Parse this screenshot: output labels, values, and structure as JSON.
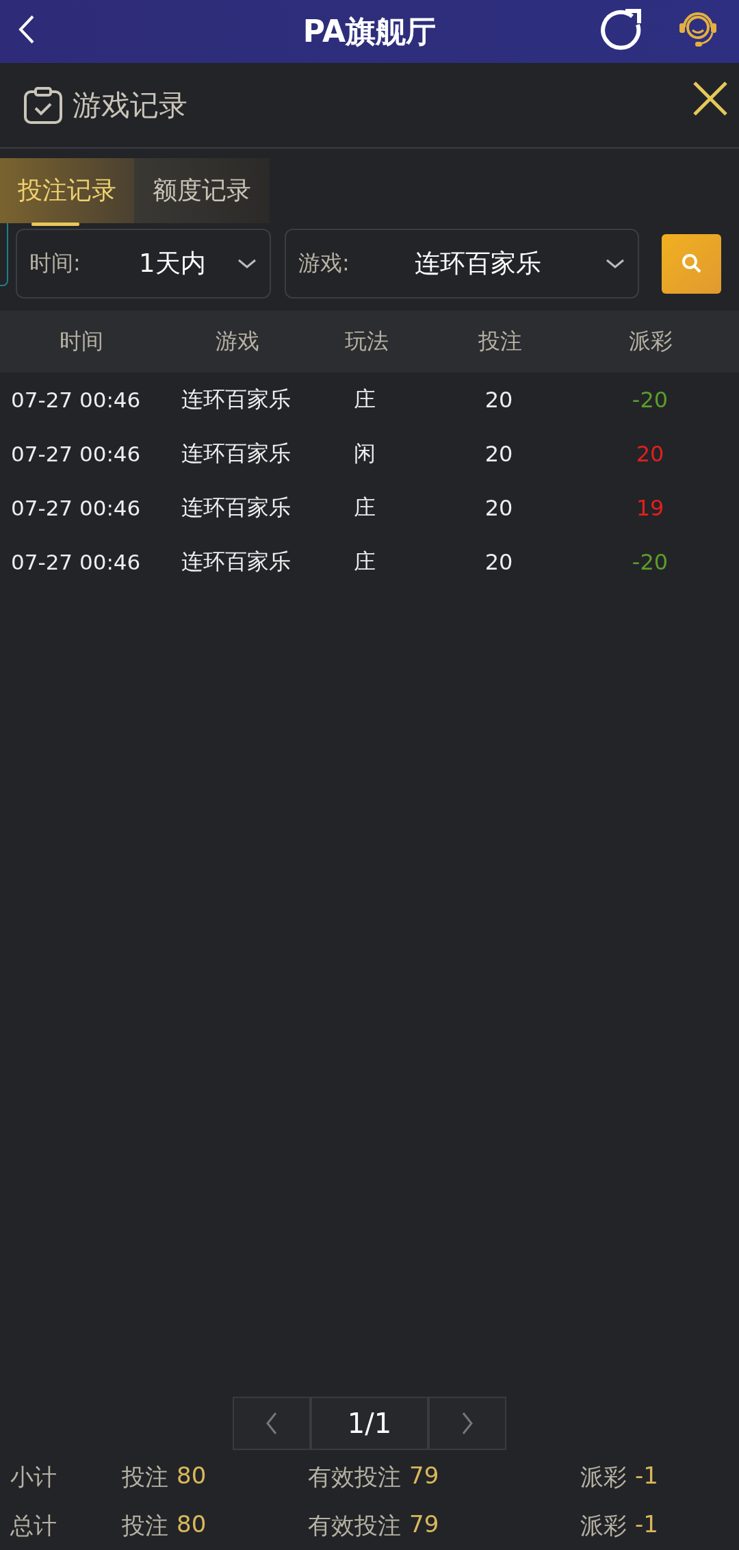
{
  "header": {
    "title": "PA旗舰厅"
  },
  "panel": {
    "title": "游戏记录"
  },
  "tabs": [
    {
      "label": "投注记录",
      "selected": true
    },
    {
      "label": "额度记录",
      "selected": false
    }
  ],
  "filters": [
    {
      "label": "时间:",
      "value": "1天内"
    },
    {
      "label": "游戏:",
      "value": "连环百家乐"
    }
  ],
  "table": {
    "columns": [
      "时间",
      "游戏",
      "玩法",
      "投注",
      "派彩"
    ],
    "rows": [
      {
        "time": "07-27 00:46",
        "game": "连环百家乐",
        "play": "庄",
        "bet": "20",
        "payout": "-20",
        "color": "#5a9e2a"
      },
      {
        "time": "07-27 00:46",
        "game": "连环百家乐",
        "play": "闲",
        "bet": "20",
        "payout": "20",
        "color": "#e0201c"
      },
      {
        "time": "07-27 00:46",
        "game": "连环百家乐",
        "play": "庄",
        "bet": "20",
        "payout": "19",
        "color": "#e0201c"
      },
      {
        "time": "07-27 00:46",
        "game": "连环百家乐",
        "play": "庄",
        "bet": "20",
        "payout": "-20",
        "color": "#5a9e2a"
      }
    ]
  },
  "pagination": {
    "page": "1/1"
  },
  "summary": [
    {
      "label": "小计",
      "items": [
        {
          "label": "投注",
          "value": "80"
        },
        {
          "label": "有效投注",
          "value": "79"
        },
        {
          "label": "派彩",
          "value": "-1"
        }
      ]
    },
    {
      "label": "总计",
      "items": [
        {
          "label": "投注",
          "value": "80"
        },
        {
          "label": "有效投注",
          "value": "79"
        },
        {
          "label": "派彩",
          "value": "-1"
        }
      ]
    }
  ]
}
